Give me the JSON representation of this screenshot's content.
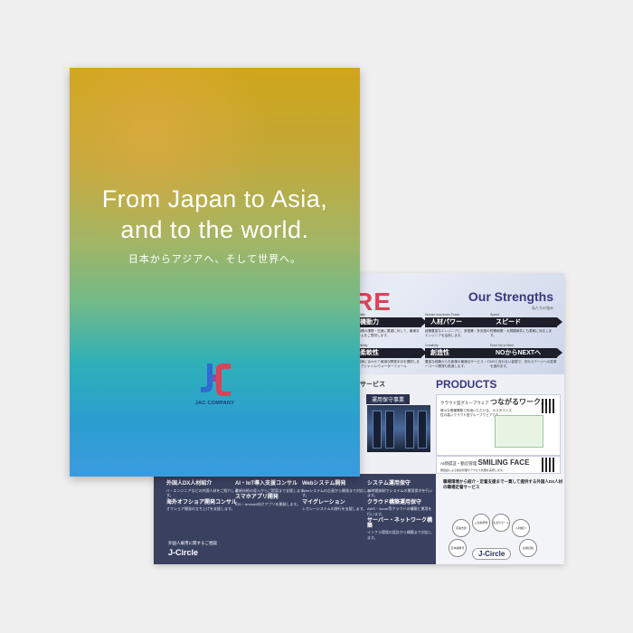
{
  "colors": {
    "background": "#efefef",
    "cover_top": "#d0a61a",
    "cover_bottom": "#3a9be0",
    "brand_navy": "#1d2550",
    "accent_red": "#e0405a",
    "accent_purple": "#3b3680"
  },
  "cover": {
    "headline_line1": "From Japan to Asia,",
    "headline_line2": "and to the world.",
    "subline": "日本からアジアへ、そして世界へ。",
    "logo_text": "JAC COMPANY"
  },
  "back": {
    "core_text": "RE",
    "strengths_title": "Our Strengths",
    "strengths_sub": "私たちの強み",
    "strengths": [
      {
        "en": "Mobility",
        "label": "機動力",
        "desc": "お客様の課題・迅速に要望に対して、最適なチームをご提供します。"
      },
      {
        "en": "Human resources Power",
        "label": "人材パワー",
        "desc": "経験豊富なエンジニアと、多国籍・多言語のエンジニアを活用します。"
      },
      {
        "en": "Speed",
        "label": "スピード",
        "desc": "短期納期・大規模案件にも柔軟に対応します。"
      },
      {
        "en": "Flexibility",
        "label": "柔軟性",
        "desc": "お客様に合わせて最適な開発手法を選択します。アジャイル/ウォーターフォール"
      },
      {
        "en": "Creativity",
        "label": "創造性",
        "desc": "豊富な経験からお客様の最適なサービス・ローコード開発も推進します。"
      },
      {
        "en": "From No to Next",
        "label": "NOからNEXTへ",
        "desc": "NOと言わない姿勢で、次のステージへの変革を進めます。"
      }
    ],
    "service_head": "サービス",
    "ops_label": "運用保守事業",
    "products_title": "PRODUCTS",
    "product1_sub": "クラウド型グループウェア",
    "product1_name": "つながるワークス",
    "product1_desc": "様々な業種業務で利用いただける、カスタマイズ性の高いクラウド型グループウェアです。",
    "product2_sub": "AI顔認証・勤怠管理",
    "product2_name": "SMILING FACE",
    "product2_desc": "顔認証による勤怠管理やアクセス管理を実現します。",
    "lower_items": [
      {
        "title": "外国人DX人材紹介",
        "desc": "IT・エンジニアなどの外国人材をご紹介します。"
      },
      {
        "title": "AI・IoT導入支援コンサル",
        "desc": "最新技術の導入からご提案まで支援します。"
      },
      {
        "title": "Webシステム開発",
        "desc": "Webシステムの企画から開発まで対応します。"
      },
      {
        "title": "システム運用保守",
        "desc": "24時間体制でシステムの運用保守を行います。"
      },
      {
        "title": "クラウド構築運用保守",
        "desc": "AWS・Azure等クラウドの構築と運用を行います。"
      },
      {
        "title": "スマホアプリ開発",
        "desc": "iOS・Android向けアプリを開発します。"
      },
      {
        "title": "サーバー・ネットワーク構築",
        "desc": "インフラ環境の設計から構築まで対応します。"
      },
      {
        "title": "マイグレーション",
        "desc": "レガシーシステムの移行を支援します。"
      },
      {
        "title": "海外オフショア開発コンサル",
        "desc": "オフショア開発の立ち上げを支援します。"
      }
    ],
    "footer_small": "外国人雇用に関するご相談",
    "footer_brand": "J-Circle",
    "services_box_text": "職場環境から紹介・定着支援まで一貫して提供する外国人DX人材の職場定着サービス",
    "jcircle_nodes": [
      "定着支援",
      "入社前研修",
      "生活サポート",
      "人材紹介",
      "日本語教育",
      "在留資格"
    ],
    "jcircle_logo": "J-Circle"
  }
}
